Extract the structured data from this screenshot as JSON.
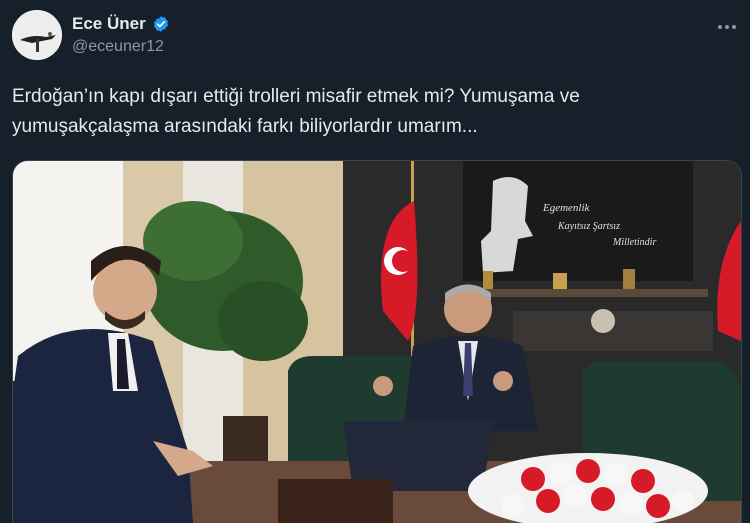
{
  "author": {
    "display_name": "Ece Üner",
    "handle": "@eceuner12",
    "verified": true,
    "avatar_icon": "avatar-photo"
  },
  "menu_icon": "more-icon",
  "tweet": {
    "text_line1": "Erdoğan’ın kapı dışarı ettiği trolleri misafir etmek mi? Yumuşama ve",
    "text_line2": "yumuşakçalaşma arasındaki farkı biliyorlardır umarım..."
  },
  "photo": {
    "wall_text_line1": "Egemenlik",
    "wall_text_line2": "Kayıtsız Şartsız",
    "wall_text_line3": "Milletindir"
  },
  "colors": {
    "background": "#15202b",
    "text": "#e7e9ea",
    "secondary_text": "#8b98a5",
    "verified": "#1d9bf0"
  }
}
